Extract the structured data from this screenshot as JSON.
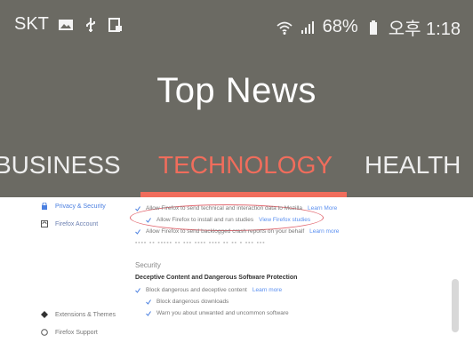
{
  "status_bar": {
    "carrier": "SKT",
    "battery": "68%",
    "time": "오후 1:18"
  },
  "app_bar": {
    "title": "Top News"
  },
  "tabs": [
    {
      "label": "BUSINESS",
      "selected": false
    },
    {
      "label": "TECHNOLOGY",
      "selected": true
    },
    {
      "label": "HEALTH",
      "selected": false
    }
  ],
  "colors": {
    "bar": "#6b6a63",
    "accent": "#f06d5c",
    "link": "#5a8ff0"
  },
  "article_image": {
    "nav": [
      "Privacy & Security",
      "Firefox Account"
    ],
    "nav_bottom": [
      "Extensions & Themes",
      "Firefox Support"
    ],
    "rows": [
      {
        "text": "Allow Firefox to send technical and interaction data to Mozilla",
        "link": "Learn More"
      },
      {
        "text": "Allow Firefox to install and run studies",
        "link": "View Firefox studies"
      },
      {
        "text": "Allow Firefox to send backlogged crash reports on your behalf",
        "link": "Learn more"
      }
    ],
    "section": "Security",
    "heading": "Deceptive Content and Dangerous Software Protection",
    "security_rows": [
      {
        "text": "Block dangerous and deceptive content",
        "link": "Learn more"
      },
      {
        "text": "Block dangerous downloads",
        "link": ""
      },
      {
        "text": "Warn you about unwanted and uncommon software",
        "link": ""
      }
    ]
  }
}
